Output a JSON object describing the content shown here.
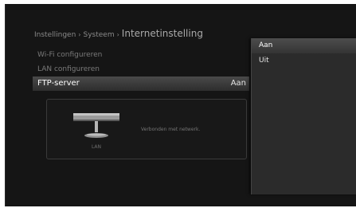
{
  "breadcrumb": {
    "item1": "Instellingen",
    "item2": "Systeem",
    "separator": "›",
    "current": "Internetinstelling"
  },
  "menu": {
    "items": [
      {
        "label": "Wi-Fi configureren"
      },
      {
        "label": "LAN configureren"
      },
      {
        "label": "FTP-server",
        "value": "Aan"
      }
    ]
  },
  "network_status": {
    "device_label": "LAN",
    "message": "Verbonden met netwerk."
  },
  "dropdown": {
    "options": [
      "Aan",
      "Uit"
    ],
    "selected": "Aan"
  },
  "colors": {
    "background": "#151515",
    "highlight": "#4a4a4a",
    "text_primary": "#ffffff",
    "text_dim": "#7a7a7a"
  },
  "icons": {
    "device": "router-icon"
  }
}
